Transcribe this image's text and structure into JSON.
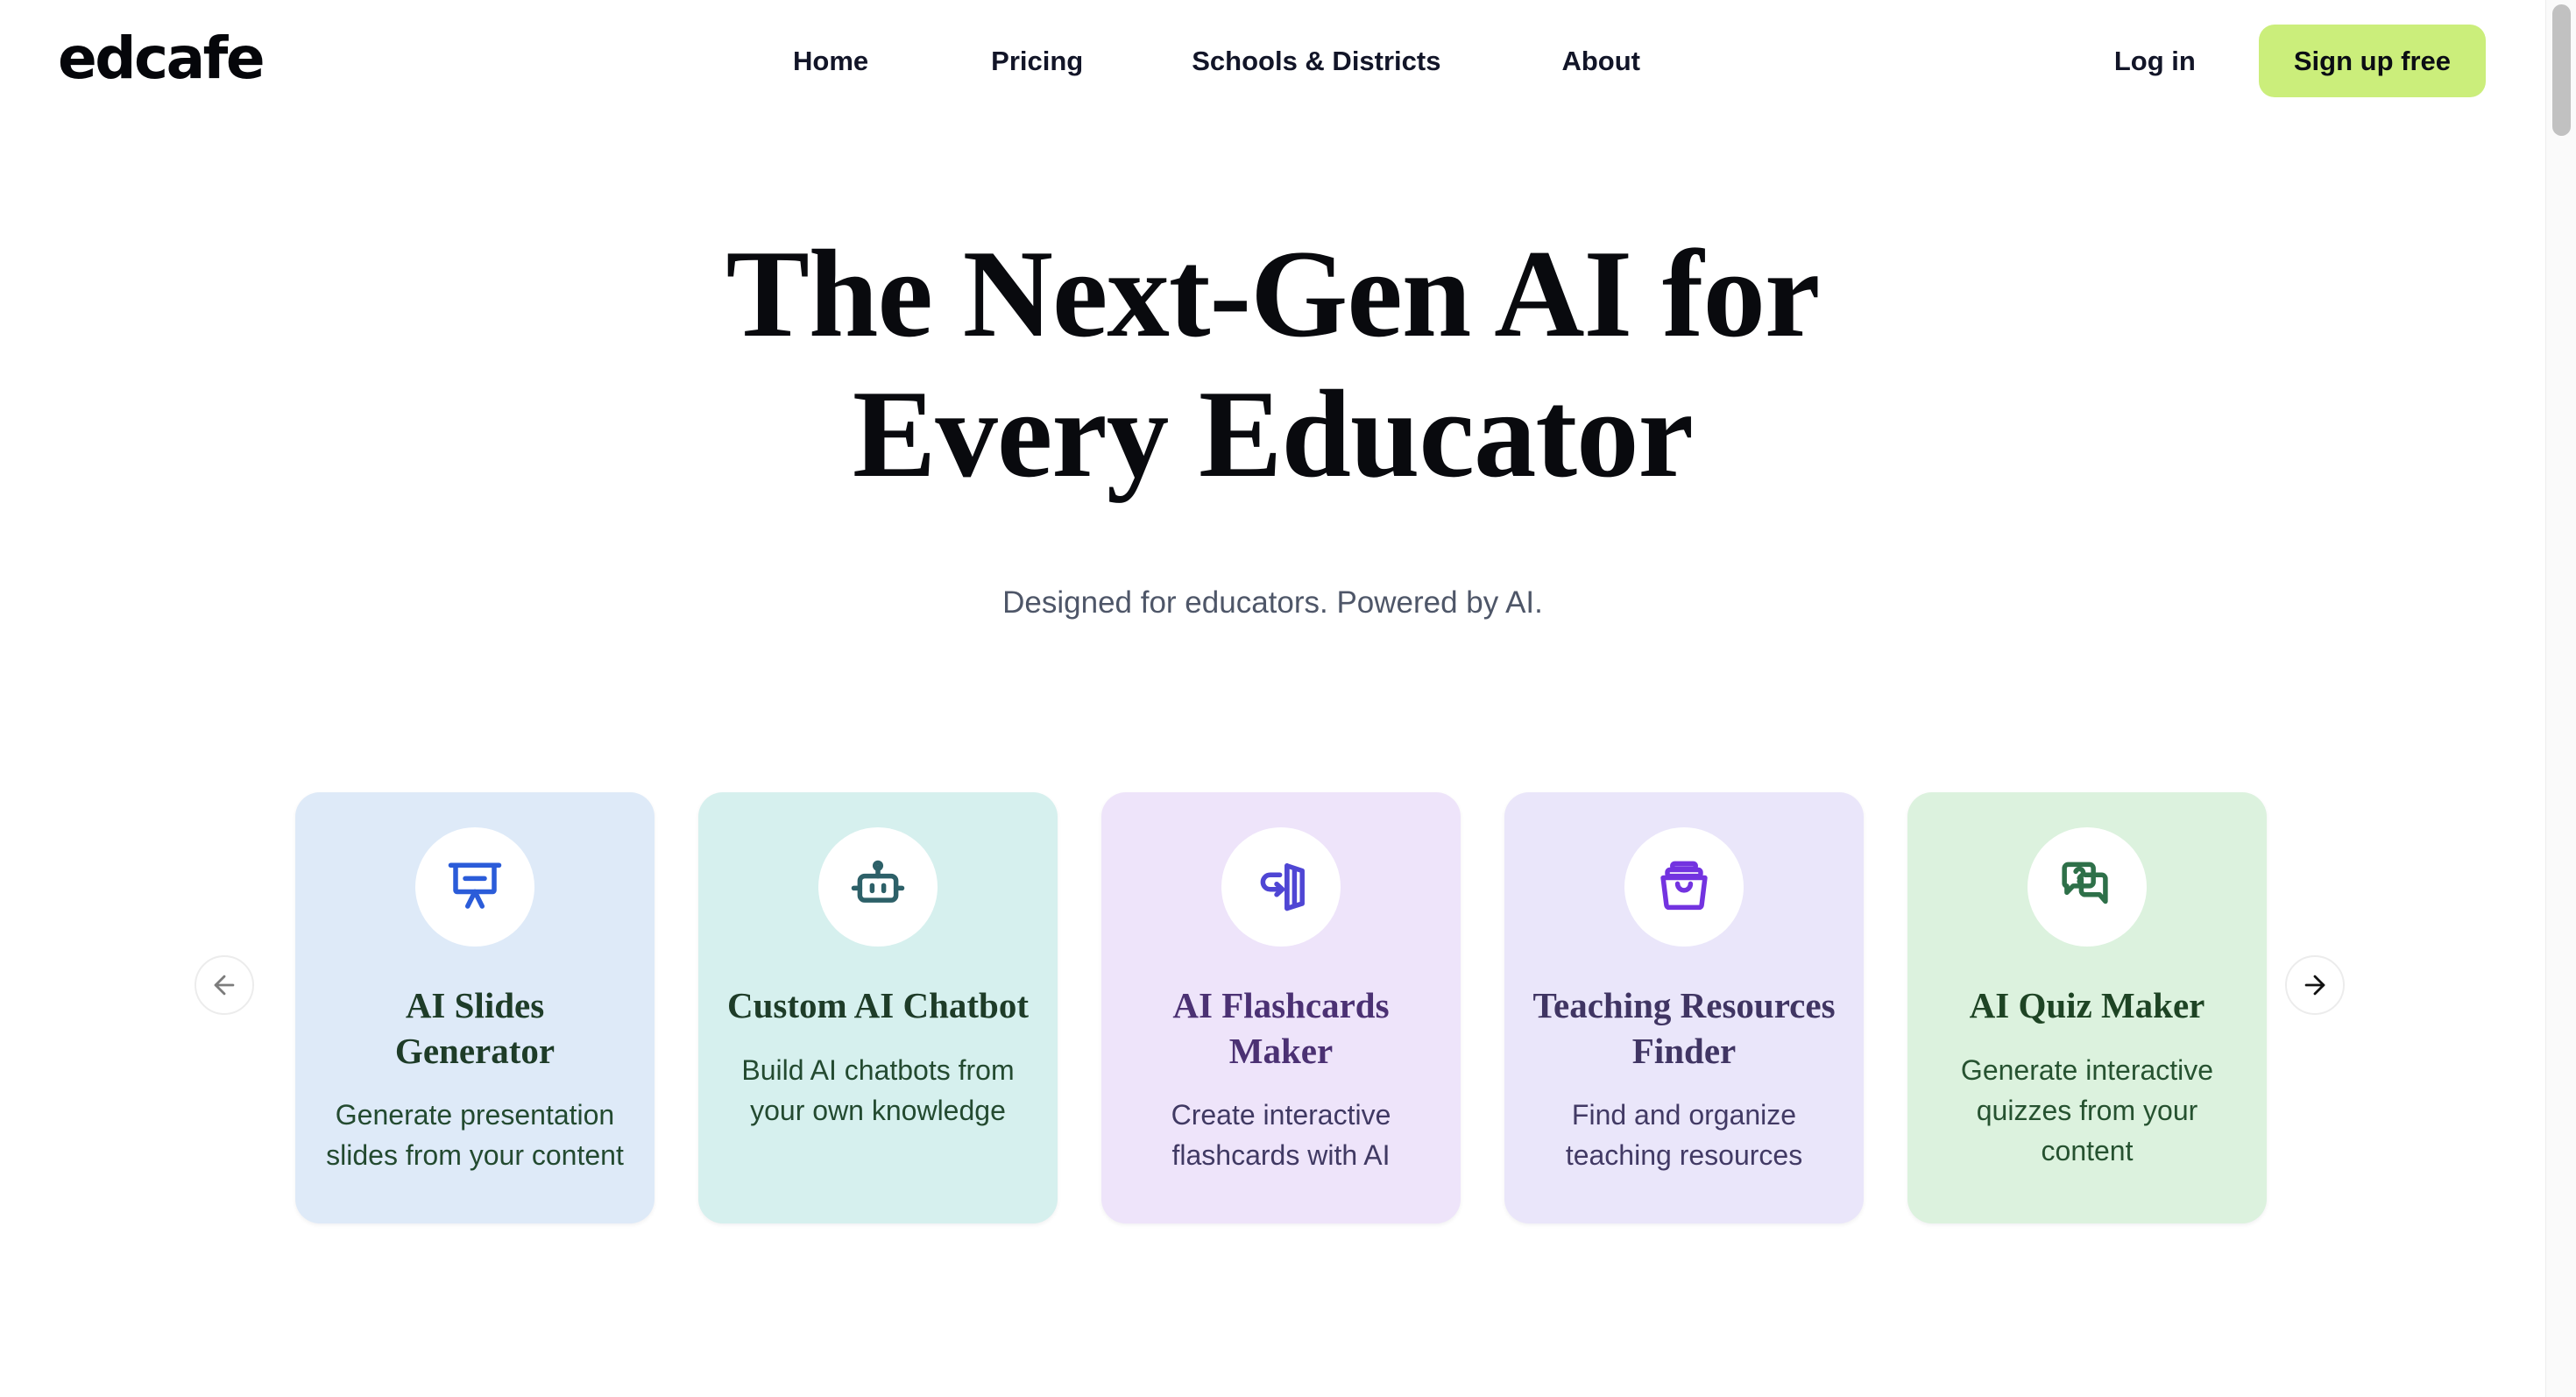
{
  "brand": {
    "logo_text": "edcafe"
  },
  "header": {
    "nav": [
      {
        "label": "Home",
        "name": "nav-link-home"
      },
      {
        "label": "Pricing",
        "name": "nav-link-pricing"
      },
      {
        "label": "Schools & Districts",
        "name": "nav-link-schools-districts"
      },
      {
        "label": "About",
        "name": "nav-link-about"
      }
    ],
    "login_label": "Log in",
    "signup_label": "Sign up free",
    "signup_bg": "#CBEE7B",
    "nav_text_color": "#121528"
  },
  "hero": {
    "title_line1": "The Next-Gen AI for",
    "title_line2": "Every Educator",
    "subtitle": "Designed for educators. Powered by AI.",
    "title_color": "#090A0E",
    "subtitle_color": "#4E5668"
  },
  "carousel": {
    "prev_icon": "arrow-left-icon",
    "next_icon": "arrow-right-icon",
    "cards": [
      {
        "title": "AI Slides Generator",
        "desc": "Generate presentation slides from your content",
        "icon": "presentation-board-icon",
        "bg": "#DEEAF8",
        "icon_color": "#2B5CD9",
        "title_color": "#1E3C28",
        "desc_color": "#234A30"
      },
      {
        "title": "Custom AI Chatbot",
        "desc": "Build AI chatbots from your own knowledge",
        "icon": "robot-icon",
        "bg": "#D6F0EE",
        "icon_color": "#2D6068",
        "title_color": "#1E3C28",
        "desc_color": "#234A30"
      },
      {
        "title": "AI Flashcards Maker",
        "desc": "Create interactive flashcards with AI",
        "icon": "flashcard-flip-icon",
        "bg": "#EEE4FA",
        "icon_color": "#4F46D4",
        "title_color": "#4B3173",
        "desc_color": "#403963"
      },
      {
        "title": "Teaching Resources Finder",
        "desc": "Find and organize teaching resources",
        "icon": "archive-box-icon",
        "bg": "#EAE6FA",
        "icon_color": "#7333E0",
        "title_color": "#403563",
        "desc_color": "#423A65"
      },
      {
        "title": "AI Quiz Maker",
        "desc": "Generate interactive quizzes from your content",
        "icon": "quiz-chat-bubbles-icon",
        "bg": "#DCF2DE",
        "icon_color": "#2E7049",
        "title_color": "#1E4424",
        "desc_color": "#265230"
      }
    ]
  },
  "scrollbar": {
    "thumb_color": "#C1C1C1"
  }
}
